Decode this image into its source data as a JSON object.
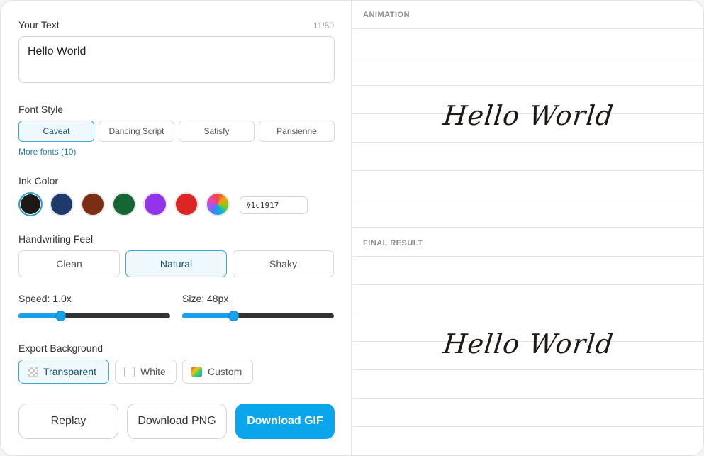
{
  "text_input": {
    "label": "Your Text",
    "counter": "11/50",
    "value": "Hello World"
  },
  "font_style": {
    "label": "Font Style",
    "options": [
      "Caveat",
      "Dancing Script",
      "Satisfy",
      "Parisienne"
    ],
    "selected": "Caveat",
    "more_link": "More fonts (10)"
  },
  "ink_color": {
    "label": "Ink Color",
    "swatches": [
      "#1c1917",
      "#1e3a6b",
      "#7a2e12",
      "#166534",
      "#9333ea",
      "#dc2626",
      "rainbow"
    ],
    "selected": "#1c1917",
    "hex_value": "#1c1917"
  },
  "handwriting_feel": {
    "label": "Handwriting Feel",
    "options": [
      "Clean",
      "Natural",
      "Shaky"
    ],
    "selected": "Natural"
  },
  "speed": {
    "label": "Speed: 1.0x",
    "fraction": 0.28
  },
  "size": {
    "label": "Size: 48px",
    "fraction": 0.34
  },
  "export_background": {
    "label": "Export Background",
    "options": [
      "Transparent",
      "White",
      "Custom"
    ],
    "selected": "Transparent"
  },
  "actions": {
    "replay": "Replay",
    "download_png": "Download PNG",
    "download_gif": "Download GIF"
  },
  "preview": {
    "animation_title": "ANIMATION",
    "final_title": "FINAL RESULT",
    "animation_text": "Hello World",
    "final_text": "Hello World"
  },
  "colors": {
    "accent": "#0ba5ec",
    "selected_border": "#3aa8d8",
    "selected_bg": "#eef8fd",
    "link": "#1b7fb4",
    "ink": "#1c1917"
  }
}
